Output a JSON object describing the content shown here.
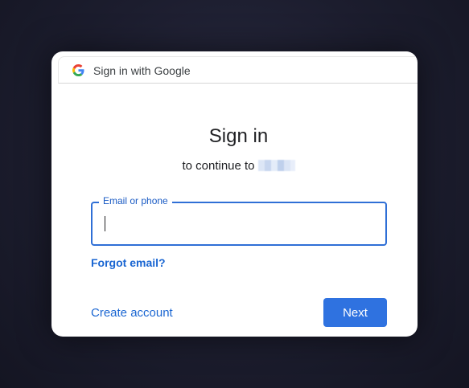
{
  "header": {
    "title": "Sign in with Google",
    "logo_icon": "google-g-icon"
  },
  "main": {
    "heading": "Sign in",
    "subtitle": "to continue to"
  },
  "form": {
    "email_label": "Email or phone",
    "email_value": "",
    "forgot_label": "Forgot email?"
  },
  "footer": {
    "create_account_label": "Create account",
    "next_label": "Next"
  },
  "colors": {
    "accent": "#2f72e0",
    "link": "#1a66d2",
    "field_border": "#2f6fd6"
  }
}
